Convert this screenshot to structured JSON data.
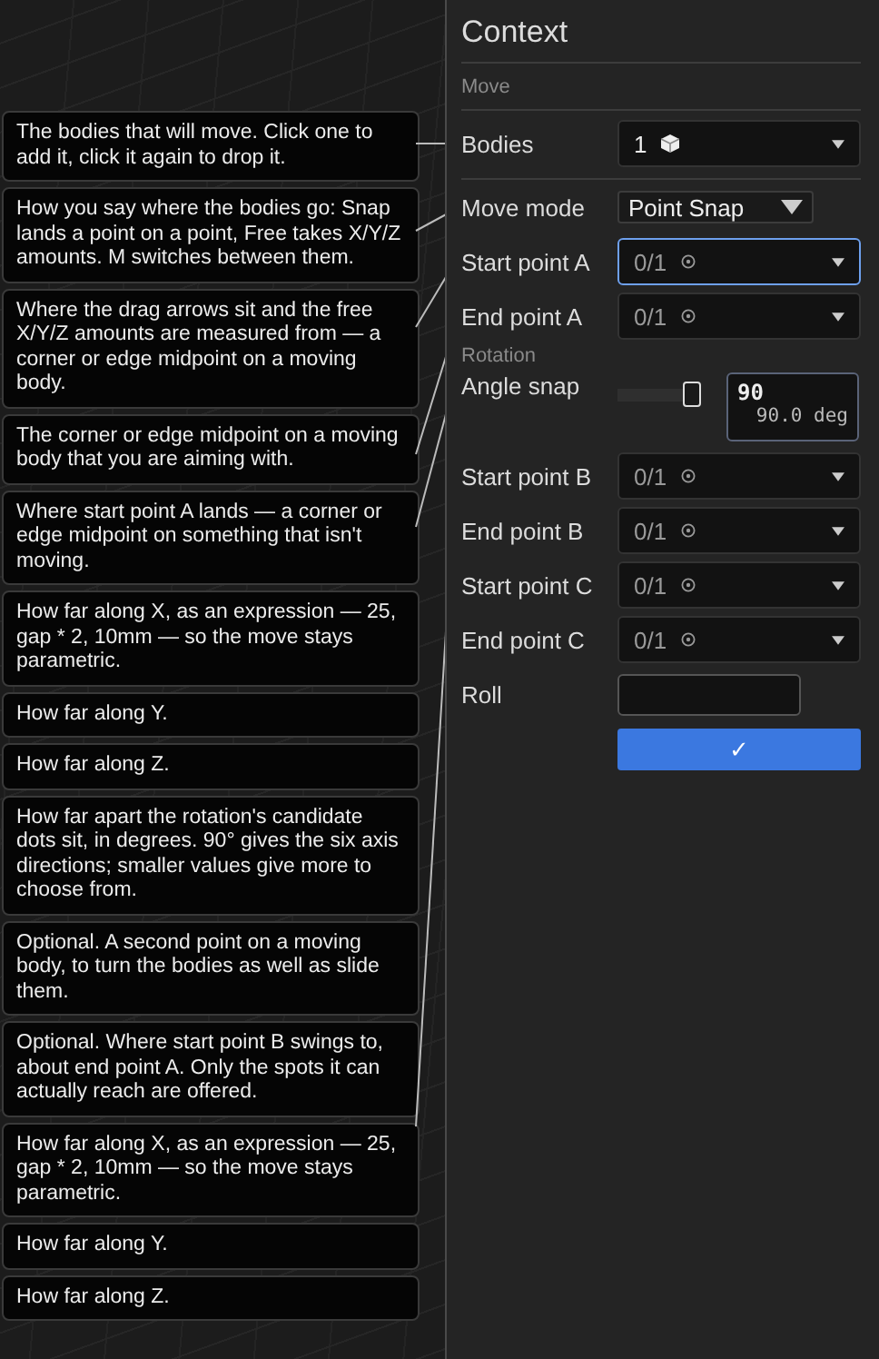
{
  "tooltips": [
    "The bodies that will move. Click one to add it, click it again to drop it.",
    "How you say where the bodies go: Snap lands a point on a point, Free takes X/Y/Z amounts. M switches between them.",
    "Where the drag arrows sit and the free X/Y/Z amounts are measured from — a corner or edge midpoint on a moving body.",
    "The corner or edge midpoint on a moving body that you are aiming with.",
    "Where start point A lands — a corner or edge midpoint on something that isn't moving.",
    "How far along X, as an expression — 25, gap * 2, 10mm — so the move stays parametric.",
    "How far along Y.",
    "How far along Z.",
    "How far apart the rotation's candidate dots sit, in degrees. 90° gives the six axis directions; smaller values give more to choose from.",
    "Optional. A second point on a moving body, to turn the bodies as well as slide them.",
    "Optional. Where start point B swings to, about end point A. Only the spots it can actually reach are offered.",
    "How far along X, as an expression — 25, gap * 2, 10mm — so the move stays parametric.",
    "How far along Y.",
    "How far along Z."
  ],
  "panel": {
    "title": "Context",
    "section": "Move",
    "rows": [
      {
        "kind": "body_select",
        "label": "Bodies",
        "value": "1",
        "focused": false
      },
      {
        "kind": "dropdown",
        "label": "Move mode",
        "value": "Point Snap"
      },
      {
        "kind": "point_select",
        "label": "Start point A",
        "value": "0/1",
        "focused": true
      },
      {
        "kind": "point_select",
        "label": "End point A",
        "value": "0/1",
        "focused": false
      },
      {
        "kind": "heading",
        "label": "Rotation"
      },
      {
        "kind": "slider",
        "label": "Angle snap",
        "level": 1,
        "value": "90",
        "reading": "90.0 deg"
      },
      {
        "kind": "point_select",
        "label": "Start point B",
        "value": "0/1",
        "focused": false
      },
      {
        "kind": "point_select",
        "label": "End point B",
        "value": "0/1",
        "focused": false
      },
      {
        "kind": "point_select",
        "label": "Start point C",
        "value": "0/1",
        "focused": false
      },
      {
        "kind": "point_select",
        "label": "End point C",
        "value": "0/1",
        "focused": false
      },
      {
        "kind": "text",
        "label": "Roll"
      },
      {
        "kind": "confirm",
        "label": "✓"
      }
    ]
  }
}
